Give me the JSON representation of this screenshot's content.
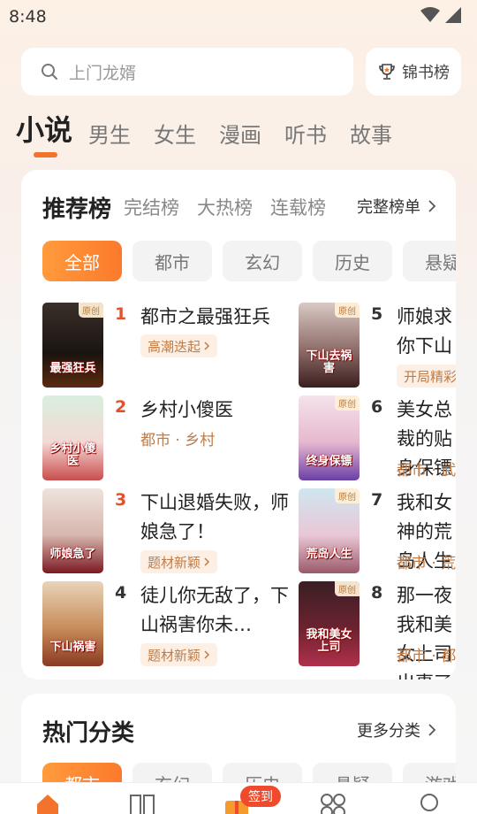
{
  "status_bar": {
    "time": "8:48"
  },
  "search": {
    "placeholder": "上门龙婿"
  },
  "rank_button": {
    "label": "锦书榜"
  },
  "top_tabs": [
    "小说",
    "男生",
    "女生",
    "漫画",
    "听书",
    "故事"
  ],
  "ranking_card": {
    "title": "推荐榜",
    "subtabs": [
      "完结榜",
      "大热榜",
      "连载榜"
    ],
    "full_list_label": "完整榜单",
    "chips": [
      "全部",
      "都市",
      "玄幻",
      "历史",
      "悬疑"
    ],
    "books": [
      {
        "rank": "1",
        "title": "都市之最强狂兵",
        "tag": "高潮迭起",
        "cover_tag": "原创",
        "cover_text": "最强狂兵"
      },
      {
        "rank": "2",
        "title": "乡村小傻医",
        "category": "都市 · 乡村",
        "cover_text": "乡村小傻医"
      },
      {
        "rank": "3",
        "title": "下山退婚失败，师娘急了！",
        "tag": "题材新颖",
        "cover_text": "师娘急了"
      },
      {
        "rank": "4",
        "title": "徒儿你无敌了，下山祸害你未…",
        "tag": "题材新颖",
        "cover_text": "下山祸害"
      },
      {
        "rank": "5",
        "title": "师娘求你下山去祸害",
        "tag": "开局精彩",
        "cover_tag": "原创",
        "cover_text": "下山去祸害"
      },
      {
        "rank": "6",
        "title": "美女总裁的贴身保镖",
        "category": "都市 · 武",
        "cover_tag": "原创",
        "cover_text": "终身保镖"
      },
      {
        "rank": "7",
        "title": "我和女神的荒岛人生",
        "category": "都市 · 荒",
        "cover_tag": "原创",
        "cover_text": "荒岛人生"
      },
      {
        "rank": "8",
        "title": "那一夜我和美女上司出事了",
        "category": "都市 · 都",
        "cover_tag": "原创",
        "cover_text": "我和美女上司"
      }
    ]
  },
  "category_card": {
    "title": "热门分类",
    "more_label": "更多分类",
    "chips": [
      "都市",
      "玄幻",
      "历史",
      "悬疑",
      "游戏"
    ]
  },
  "bottom_nav": {
    "signin_badge": "签到"
  },
  "colors": {
    "accent": "#f3722c",
    "rank_red": "#e2502c",
    "tag_text": "#c07c47"
  }
}
